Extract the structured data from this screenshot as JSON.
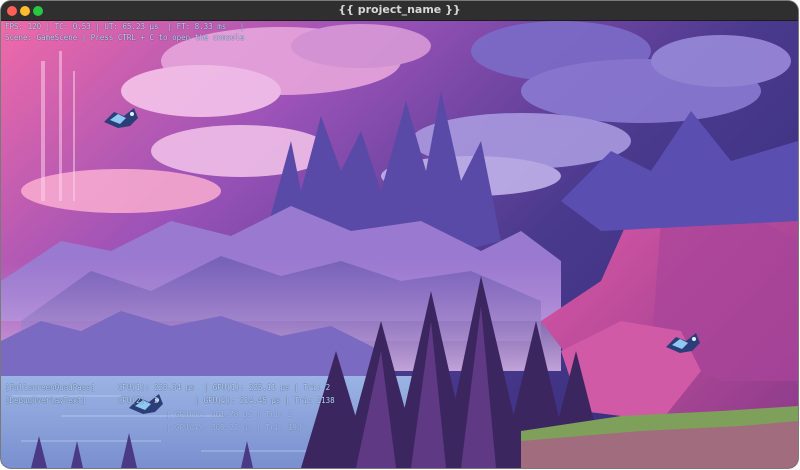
{
  "window": {
    "title": "{{ project_name }}"
  },
  "hud": {
    "stats": "FPS: 120 | TC: 0.53 | UT: 65.23 µs  | FT: 8.33 ms   | ",
    "console_hint": "Scene: GameScene | Press CTRL + C to open the console",
    "passes": [
      {
        "text": "[FullscreenQuadPass]     CPU(1): 223.34 µs  | GPU(1): 225.11 µs | Tri: 2"
      },
      {
        "text": "[DebugOverlayText]       CPU(2): 2        | GPU(2): 214.45 µs | Tri: 1138"
      }
    ],
    "extra": [
      {
        "text": "| GPU(3): 301.78 µs | Tri: 2"
      },
      {
        "text": "| GPU(4): 305.22 µs | Tri: 190"
      }
    ]
  },
  "colors": {
    "sky_top": "#3a2a7a",
    "sky_pink": "#e85a9a",
    "mountain_purple": "#8a6ac8",
    "cliff_magenta": "#c44a9a",
    "forest_dark": "#3a2458",
    "water": "#8aa6d8"
  },
  "sprites": [
    {
      "name": "flying-creature-top-left"
    },
    {
      "name": "flying-creature-bottom-left"
    },
    {
      "name": "flying-creature-right"
    }
  ]
}
